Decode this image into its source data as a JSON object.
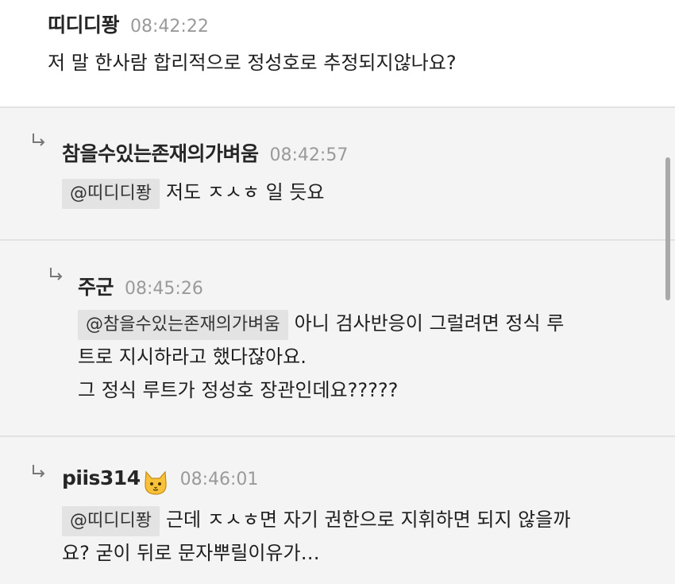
{
  "comments": [
    {
      "nick": "띠디디퐝",
      "time": "08:42:22",
      "lines": [
        "저 말 한사람 합리적으로 정성호로 추정되지않나요?"
      ]
    },
    {
      "nick": "참을수있는존재의가벼움",
      "time": "08:42:57",
      "mention": "@띠디디퐝",
      "lines": [
        "저도 ㅈㅅㅎ 일 듯요"
      ]
    },
    {
      "nick": "주군",
      "time": "08:45:26",
      "mention": "@참을수있는존재의가벼움",
      "lines": [
        "아니 검사반응이 그럴려면 정식 루",
        "트로 지시하라고 했다잖아요.",
        "그 정식 루트가 정성호 장관인데요?????"
      ]
    },
    {
      "nick": "piis314",
      "time": "08:46:01",
      "emoji": "cat-face-icon",
      "mention": "@띠디디퐝",
      "lines": [
        "근데 ㅈㅅㅎ면 자기 권한으로 지휘하면 되지 않을까",
        "요? 굳이 뒤로 문자뿌릴이유가…"
      ]
    }
  ]
}
